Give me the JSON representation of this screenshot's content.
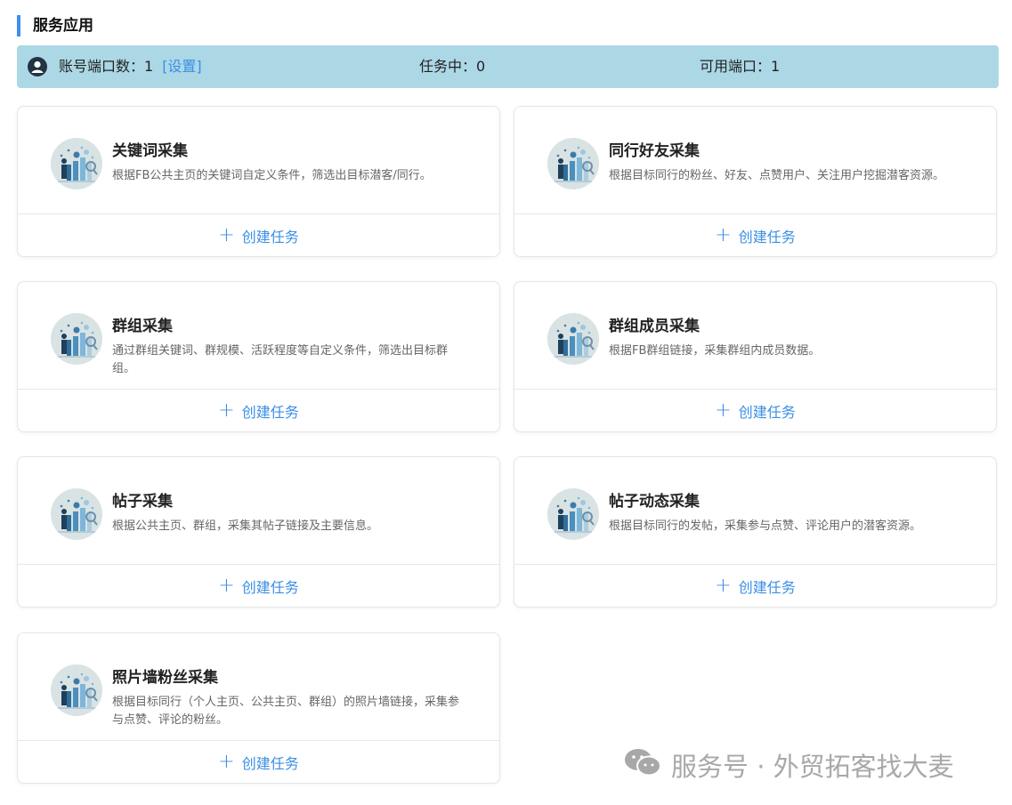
{
  "section": {
    "title": "服务应用"
  },
  "stats": {
    "ports_label": "账号端口数：1",
    "settings_link": "[设置]",
    "in_task_label": "任务中：0",
    "available_label": "可用端口：1"
  },
  "cards": [
    {
      "title": "关键词采集",
      "desc": "根据FB公共主页的关键词自定义条件，筛选出目标潜客/同行。",
      "action": "创建任务"
    },
    {
      "title": "同行好友采集",
      "desc": "根据目标同行的粉丝、好友、点赞用户、关注用户挖掘潜客资源。",
      "action": "创建任务"
    },
    {
      "title": "群组采集",
      "desc": "通过群组关键词、群规模、活跃程度等自定义条件，筛选出目标群组。",
      "action": "创建任务"
    },
    {
      "title": "群组成员采集",
      "desc": "根据FB群组链接，采集群组内成员数据。",
      "action": "创建任务"
    },
    {
      "title": "帖子采集",
      "desc": "根据公共主页、群组，采集其帖子链接及主要信息。",
      "action": "创建任务"
    },
    {
      "title": "帖子动态采集",
      "desc": "根据目标同行的发帖，采集参与点赞、评论用户的潜客资源。",
      "action": "创建任务"
    },
    {
      "title": "照片墙粉丝采集",
      "desc": "根据目标同行（个人主页、公共主页、群组）的照片墙链接，采集参与点赞、评论的粉丝。",
      "action": "创建任务"
    }
  ],
  "watermark": {
    "text": "服务号 · 外贸拓客找大麦"
  },
  "icons": {
    "card_icon": "business-people-chart-icon",
    "avatar": "user-avatar-icon",
    "plus": "plus-icon",
    "wechat": "wechat-icon"
  },
  "colors": {
    "accent": "#3a8ee6",
    "stats_bg": "#acd8e6",
    "title_bar": "#3f8ef0"
  }
}
